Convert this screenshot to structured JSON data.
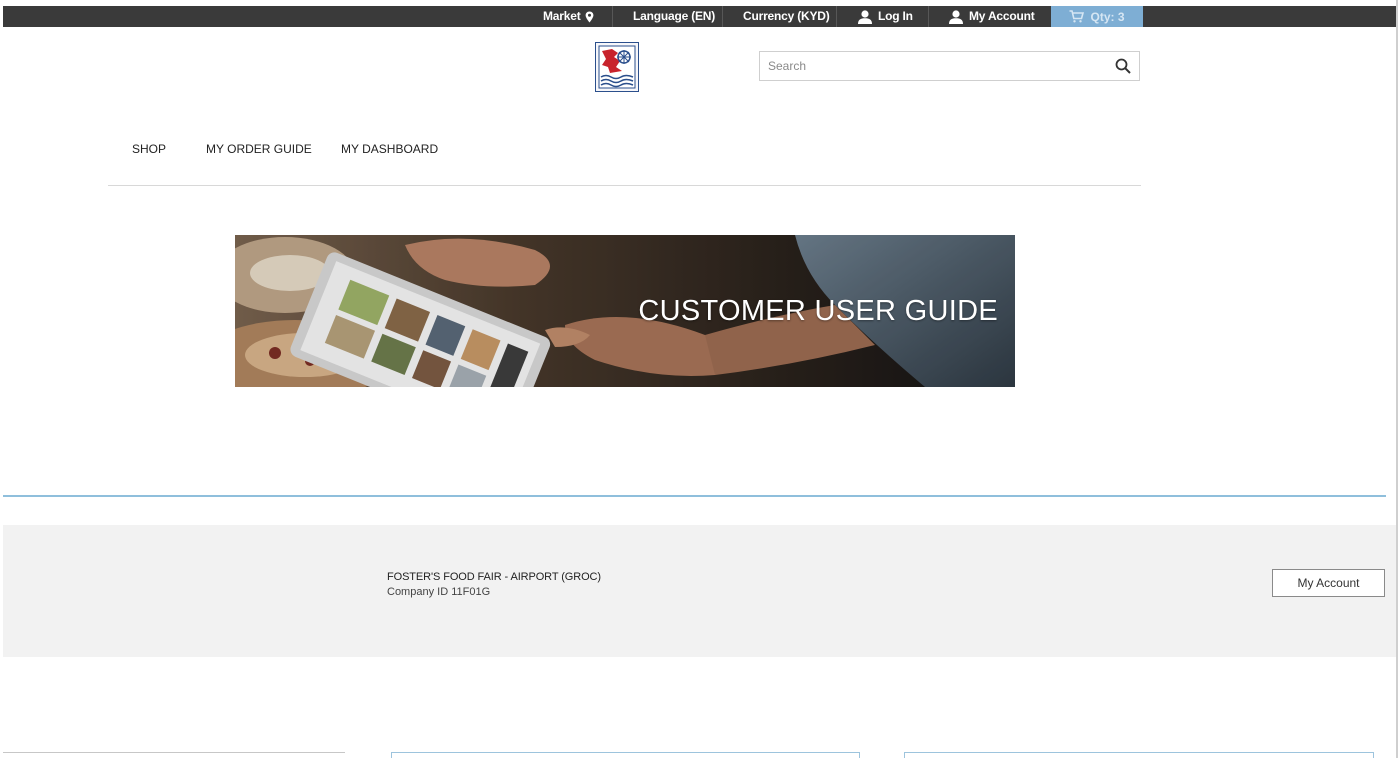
{
  "topbar": {
    "market_label": "Market",
    "language_label": "Language (EN)",
    "currency_label": "Currency (KYD)",
    "login_label": "Log In",
    "account_label": "My Account",
    "cart_label": "Qty: 3"
  },
  "search": {
    "placeholder": "Search"
  },
  "nav": {
    "items": [
      {
        "label": "SHOP"
      },
      {
        "label": "MY ORDER GUIDE"
      },
      {
        "label": "MY DASHBOARD"
      }
    ]
  },
  "banner": {
    "title": "CUSTOMER USER GUIDE"
  },
  "account": {
    "company_name": "FOSTER'S FOOD FAIR - AIRPORT (GROC)",
    "company_id_prefix": "Company ID",
    "company_id": "11F01G",
    "button_label": "My Account"
  },
  "colors": {
    "topbar_bg": "#3a3a3a",
    "cart_bg": "#7eaed4",
    "rule": "#8fbfdc",
    "strip_bg": "#f2f2f2"
  },
  "icons": {
    "market": "map-pin-icon",
    "login": "user-icon",
    "account": "user-icon",
    "cart": "cart-icon",
    "search": "magnifier-icon"
  }
}
